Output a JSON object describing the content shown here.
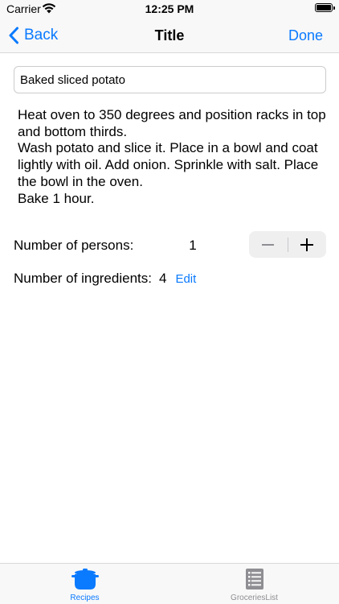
{
  "status_bar": {
    "carrier": "Carrier",
    "time": "12:25 PM",
    "battery_level": 1.0
  },
  "nav_bar": {
    "back_label": "Back",
    "title": "Title",
    "done_label": "Done",
    "accent_color": "#0a7aff"
  },
  "recipe": {
    "name": "Baked sliced potato",
    "instructions": "Heat oven to 350 degrees and position racks in top and bottom thirds.\nWash potato and slice it. Place in a bowl and coat lightly with oil. Add onion. Sprinkle with salt. Place the bowl in the oven.\nBake 1 hour.",
    "persons_label": "Number of persons:",
    "persons_value": "1",
    "ingredients_label": "Number of ingredients:",
    "ingredients_value": "4",
    "edit_label": "Edit"
  },
  "stepper": {
    "decrement_icon": "minus-icon",
    "increment_icon": "plus-icon"
  },
  "tab_bar": {
    "tabs": [
      {
        "label": "Recipes",
        "icon": "pot-icon",
        "selected": true
      },
      {
        "label": "GroceriesList",
        "icon": "list-icon",
        "selected": false
      }
    ]
  }
}
